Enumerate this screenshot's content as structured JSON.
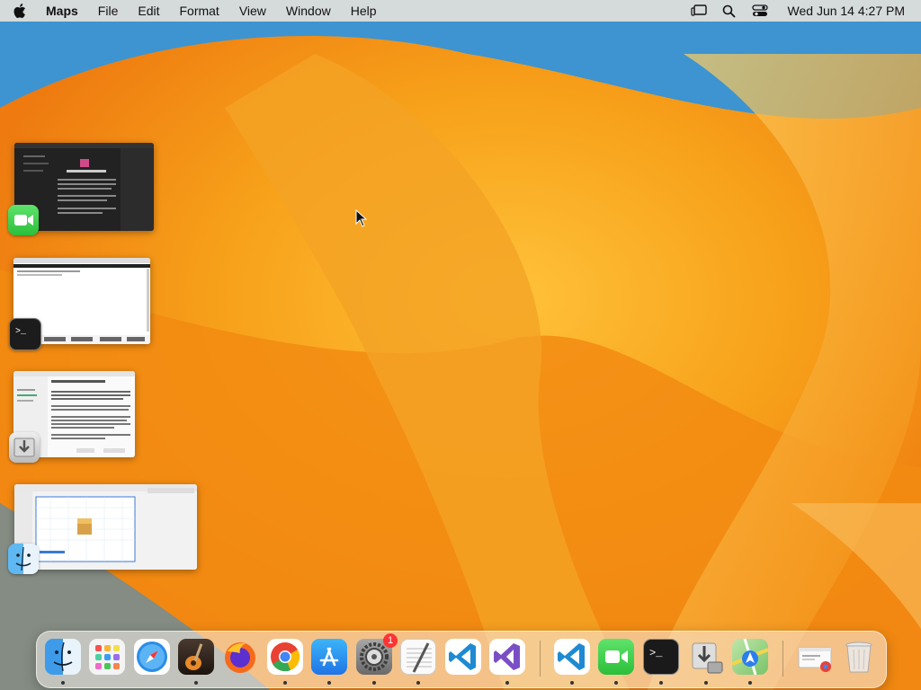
{
  "menubar": {
    "app_name": "Maps",
    "menus": [
      "File",
      "Edit",
      "Format",
      "View",
      "Window",
      "Help"
    ],
    "clock": "Wed Jun 14  4:27 PM"
  },
  "stage_manager": {
    "groups": [
      {
        "app": "FaceTime",
        "icon": "facetime-icon"
      },
      {
        "app": "Terminal",
        "icon": "terminal-icon"
      },
      {
        "app": "Installer",
        "icon": "installer-icon"
      },
      {
        "app": "Finder",
        "icon": "finder-icon"
      }
    ]
  },
  "dock": {
    "apps": [
      {
        "name": "Finder",
        "icon": "finder-icon",
        "running": true
      },
      {
        "name": "Launchpad",
        "icon": "launchpad-icon",
        "running": false
      },
      {
        "name": "Safari",
        "icon": "safari-icon",
        "running": false
      },
      {
        "name": "GarageBand",
        "icon": "garageband-icon",
        "running": true
      },
      {
        "name": "Firefox",
        "icon": "firefox-icon",
        "running": false
      },
      {
        "name": "Chrome",
        "icon": "chrome-icon",
        "running": true
      },
      {
        "name": "App Store",
        "icon": "app-store-icon",
        "running": true
      },
      {
        "name": "System Settings",
        "icon": "settings-icon",
        "running": true,
        "badge": "1"
      },
      {
        "name": "TextEdit",
        "icon": "textedit-icon",
        "running": true
      },
      {
        "name": "Visual Studio Code",
        "icon": "vscode-icon",
        "running": false
      },
      {
        "name": "Visual Studio",
        "icon": "visual-studio-icon",
        "running": true
      },
      {
        "name": "Visual Studio Code",
        "icon": "vscode-icon",
        "running": true
      },
      {
        "name": "FaceTime",
        "icon": "facetime-icon",
        "running": true
      },
      {
        "name": "Terminal",
        "icon": "terminal-icon",
        "running": true
      },
      {
        "name": "Installer",
        "icon": "installer-icon",
        "running": true
      },
      {
        "name": "Maps",
        "icon": "maps-icon",
        "running": true
      },
      {
        "name": "Chrome Downloads",
        "icon": "downloads-stack-icon",
        "running": false
      },
      {
        "name": "Trash",
        "icon": "trash-icon",
        "running": false
      }
    ]
  },
  "colors": {
    "accent": "#f08a10",
    "menubar": "#ebe4dc"
  }
}
